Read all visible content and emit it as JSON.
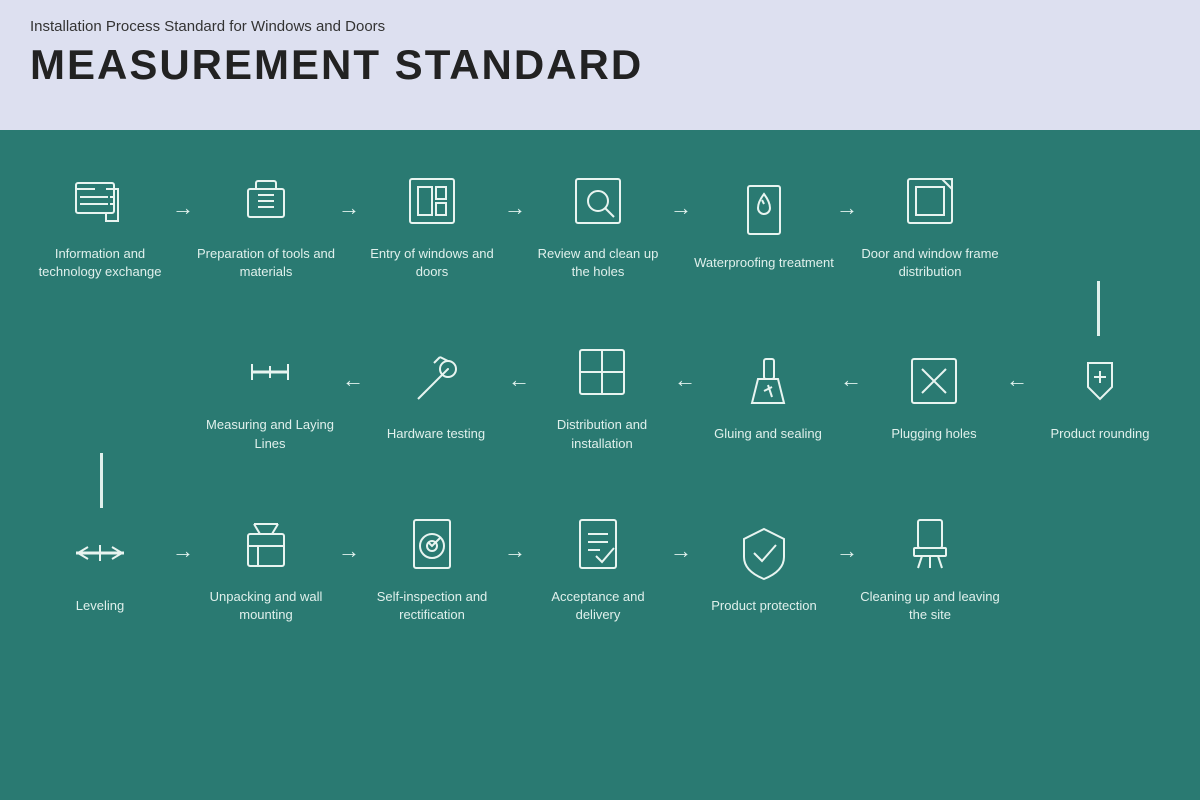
{
  "header": {
    "subtitle": "Installation Process Standard for Windows and Doors",
    "title": "MEASUREMENT STANDARD"
  },
  "row1": {
    "steps": [
      {
        "id": "info-exchange",
        "label": "Information and technology exchange"
      },
      {
        "id": "preparation",
        "label": "Preparation of tools and materials"
      },
      {
        "id": "entry-windows",
        "label": "Entry of windows and doors"
      },
      {
        "id": "review-holes",
        "label": "Review and clean up the holes"
      },
      {
        "id": "waterproofing",
        "label": "Waterproofing treatment"
      },
      {
        "id": "frame-distribution",
        "label": "Door and window frame distribution"
      }
    ]
  },
  "row2": {
    "steps": [
      {
        "id": "measuring",
        "label": "Measuring and Laying Lines"
      },
      {
        "id": "hardware-testing",
        "label": "Hardware testing"
      },
      {
        "id": "distribution-install",
        "label": "Distribution and installation"
      },
      {
        "id": "gluing",
        "label": "Gluing and sealing"
      },
      {
        "id": "plugging",
        "label": "Plugging holes"
      },
      {
        "id": "product-rounding",
        "label": "Product rounding"
      }
    ]
  },
  "row3": {
    "steps": [
      {
        "id": "leveling",
        "label": "Leveling"
      },
      {
        "id": "unpacking",
        "label": "Unpacking and wall mounting"
      },
      {
        "id": "self-inspection",
        "label": "Self-inspection and rectification"
      },
      {
        "id": "acceptance",
        "label": "Acceptance and delivery"
      },
      {
        "id": "product-protection",
        "label": "Product protection"
      },
      {
        "id": "cleaning-up",
        "label": "Cleaning up and leaving the site"
      }
    ]
  }
}
